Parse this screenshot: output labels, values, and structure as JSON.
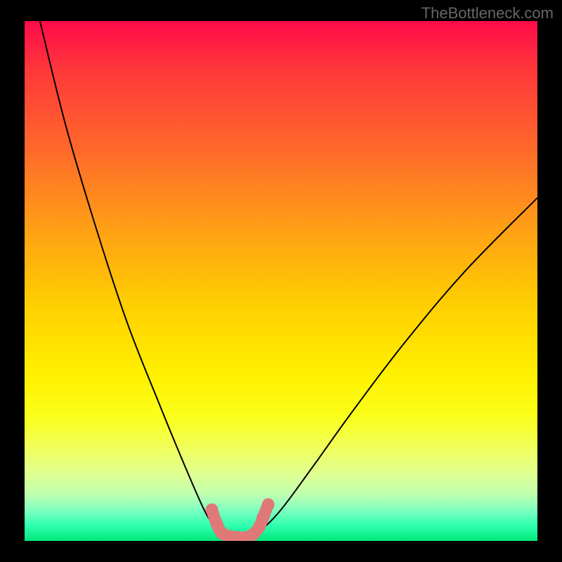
{
  "watermark": "TheBottleneck.com",
  "chart_data": {
    "type": "line",
    "title": "",
    "xlabel": "",
    "ylabel": "",
    "xlim": [
      0,
      100
    ],
    "ylim": [
      0,
      100
    ],
    "series": [
      {
        "name": "left-curve",
        "x": [
          3,
          8,
          14,
          20,
          26,
          31,
          35,
          37,
          38.5,
          40,
          42
        ],
        "y": [
          100,
          80,
          60,
          42,
          27,
          15,
          6,
          3,
          1.5,
          0.8,
          0.6
        ]
      },
      {
        "name": "right-curve",
        "x": [
          42,
          44,
          46,
          50,
          56,
          64,
          74,
          86,
          100
        ],
        "y": [
          0.6,
          0.8,
          2,
          6,
          14,
          25,
          38,
          52,
          66
        ]
      }
    ],
    "markers": {
      "name": "highlighted-points",
      "color": "#e07878",
      "points": [
        {
          "x": 36.5,
          "y": 6
        },
        {
          "x": 37.5,
          "y": 3.2
        },
        {
          "x": 38.5,
          "y": 1.5
        },
        {
          "x": 40,
          "y": 0.9
        },
        {
          "x": 41.5,
          "y": 0.7
        },
        {
          "x": 43,
          "y": 0.7
        },
        {
          "x": 44.5,
          "y": 1.2
        },
        {
          "x": 45.8,
          "y": 2.8
        },
        {
          "x": 46.5,
          "y": 4.5
        },
        {
          "x": 47.5,
          "y": 7
        }
      ]
    }
  }
}
